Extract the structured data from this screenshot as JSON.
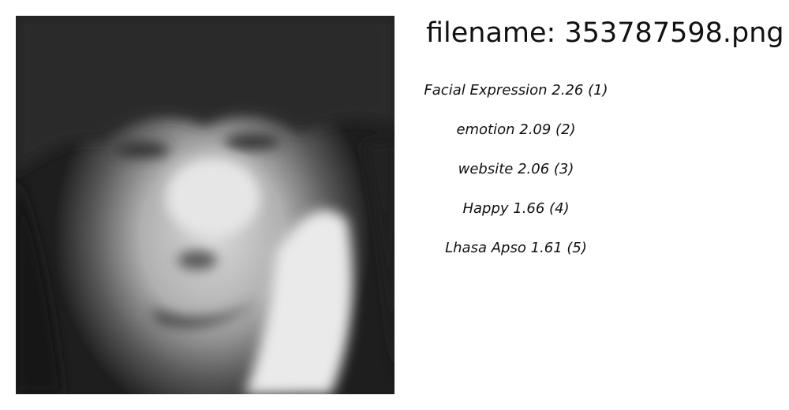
{
  "filename_label": "filename: 353787598.png",
  "image": {
    "description_icon": "grayscale-face-photo"
  },
  "labels": [
    {
      "text": "Facial Expression  2.26 (1)"
    },
    {
      "text": "emotion  2.09 (2)"
    },
    {
      "text": "website  2.06 (3)"
    },
    {
      "text": "Happy  1.66 (4)"
    },
    {
      "text": "Lhasa Apso  1.61 (5)"
    }
  ]
}
